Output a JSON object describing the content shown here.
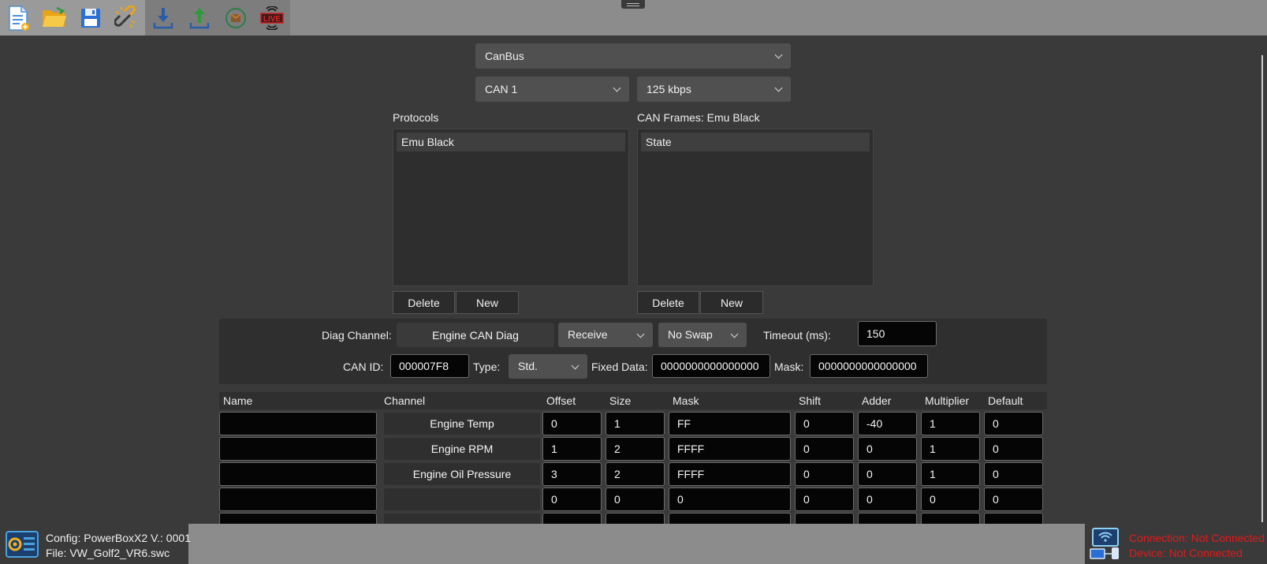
{
  "toolbar": {
    "buttons": [
      {
        "name": "new-file",
        "icon": "new-document-icon"
      },
      {
        "name": "open-file",
        "icon": "folder-open-icon"
      },
      {
        "name": "save-file",
        "icon": "floppy-disk-icon"
      },
      {
        "name": "connect",
        "icon": "chain-link-icon"
      },
      {
        "name": "download",
        "icon": "download-arrow-icon"
      },
      {
        "name": "upload",
        "icon": "upload-arrow-icon"
      },
      {
        "name": "record",
        "icon": "record-icon"
      },
      {
        "name": "live",
        "icon": "live-broadcast-icon",
        "label": "LIVE"
      }
    ]
  },
  "bus": {
    "type": "CanBus",
    "channel": "CAN 1",
    "speed": "125 kbps"
  },
  "protocols": {
    "title": "Protocols",
    "items": [
      "Emu Black"
    ],
    "delete_label": "Delete",
    "new_label": "New"
  },
  "frames": {
    "title": "CAN Frames: Emu Black",
    "items": [
      "State"
    ],
    "delete_label": "Delete",
    "new_label": "New"
  },
  "diag": {
    "channel_label": "Diag Channel:",
    "channel_value": "Engine CAN Diag",
    "direction": "Receive",
    "swap": "No Swap",
    "timeout_label": "Timeout (ms):",
    "timeout_value": "150",
    "canid_label": "CAN ID:",
    "canid_value": "000007F8",
    "type_label": "Type:",
    "type_value": "Std.",
    "fixed_label": "Fixed Data:",
    "fixed_value": "0000000000000000",
    "mask_label": "Mask:",
    "mask_value": "0000000000000000"
  },
  "grid": {
    "headers": {
      "name": "Name",
      "channel": "Channel",
      "offset": "Offset",
      "size": "Size",
      "mask": "Mask",
      "shift": "Shift",
      "adder": "Adder",
      "multiplier": "Multiplier",
      "default": "Default"
    },
    "rows": [
      {
        "name": "",
        "channel": "Engine Temp",
        "offset": "0",
        "size": "1",
        "mask": "FF",
        "shift": "0",
        "adder": "-40",
        "multiplier": "1",
        "default": "0"
      },
      {
        "name": "",
        "channel": "Engine RPM",
        "offset": "1",
        "size": "2",
        "mask": "FFFF",
        "shift": "0",
        "adder": "0",
        "multiplier": "1",
        "default": "0"
      },
      {
        "name": "",
        "channel": "Engine Oil Pressure",
        "offset": "3",
        "size": "2",
        "mask": "FFFF",
        "shift": "0",
        "adder": "0",
        "multiplier": "1",
        "default": "0"
      },
      {
        "name": "",
        "channel": "",
        "offset": "0",
        "size": "0",
        "mask": "0",
        "shift": "0",
        "adder": "0",
        "multiplier": "0",
        "default": "0"
      }
    ]
  },
  "status": {
    "config": "Config: PowerBoxX2 V.: 0001",
    "file": "File: VW_Golf2_VR6.swc",
    "connection": "Connection: Not Connected",
    "device": "Device: Not Connected"
  }
}
